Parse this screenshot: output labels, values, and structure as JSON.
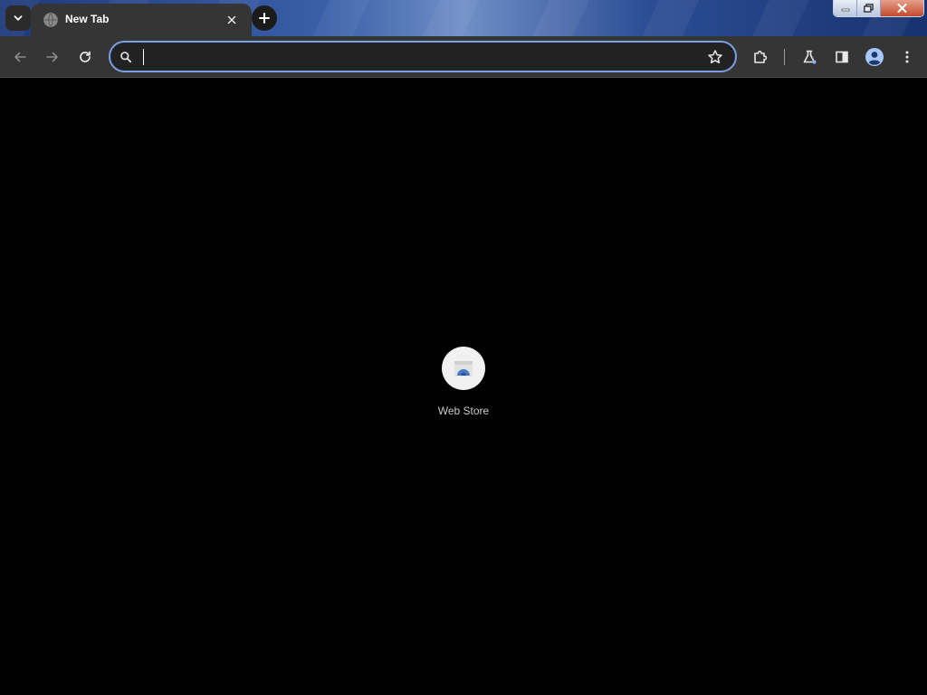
{
  "tabs": [
    {
      "title": "New Tab",
      "active": true
    }
  ],
  "omnibox": {
    "value": "",
    "placeholder": ""
  },
  "shortcuts": [
    {
      "label": "Web Store",
      "icon": "web-store-icon"
    }
  ],
  "colors": {
    "toolbar": "#353535",
    "omnibox_focus_ring": "#7c9ee6",
    "page_background": "#000000",
    "profile_avatar": "#a8c7fa"
  },
  "icons": {
    "tab_search": "chevron-down-icon",
    "tab_favicon": "globe-icon",
    "tab_close": "close-icon",
    "new_tab": "plus-icon",
    "back": "arrow-left-icon",
    "forward": "arrow-right-icon",
    "reload": "reload-icon",
    "omnibox_search": "search-icon",
    "bookmark": "star-icon",
    "extensions": "puzzle-icon",
    "labs": "flask-icon",
    "side_panel": "side-panel-icon",
    "profile": "avatar-icon",
    "menu": "kebab-menu-icon"
  }
}
